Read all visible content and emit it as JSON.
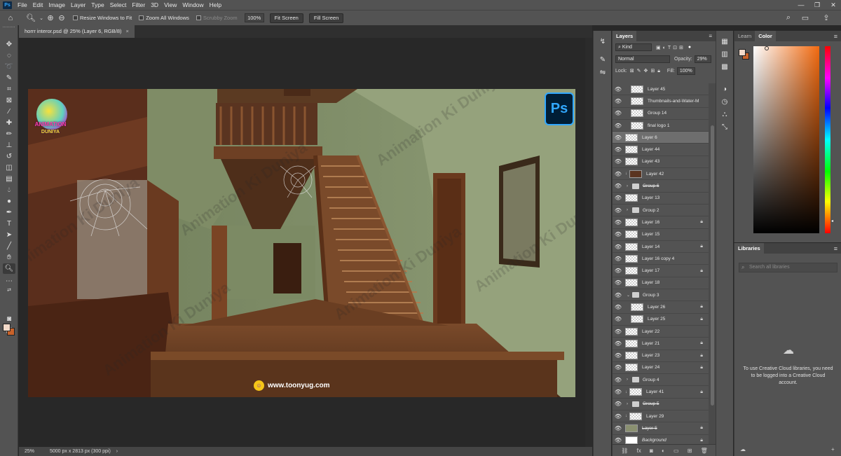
{
  "app": {
    "menu": [
      "File",
      "Edit",
      "Image",
      "Layer",
      "Type",
      "Select",
      "Filter",
      "3D",
      "View",
      "Window",
      "Help"
    ]
  },
  "options_bar": {
    "resize_windows": "Resize Windows to Fit",
    "zoom_all": "Zoom All Windows",
    "scrubby_zoom": "Scrubby Zoom",
    "zoom_value": "100%",
    "fit_screen": "Fit Screen",
    "fill_screen": "Fill Screen"
  },
  "document": {
    "tab_title": "horrr interor.psd @ 25% (Layer 6, RGB/8)",
    "tab_close": "×",
    "ps_badge": "Ps",
    "logo_line1": "ANIMATION",
    "logo_line2": "DUNIYA",
    "watermark": "Animation Ki Duniya",
    "website": "www.toonyug.com"
  },
  "status": {
    "zoom": "25%",
    "doc_info": "5000 px x 2813 px (300 ppi)"
  },
  "layers_panel": {
    "title": "Layers",
    "kind": "Kind",
    "blend": "Normal",
    "opacity_label": "Opacity:",
    "opacity_value": "29%",
    "lock_label": "Lock:",
    "fill_label": "Fill:",
    "fill_value": "100%",
    "footer_fx": "fx",
    "layers": [
      {
        "name": "Layer 45",
        "type": "layer",
        "indent": 1
      },
      {
        "name": "Thumbnails-and-Water-M",
        "type": "layer",
        "indent": 1
      },
      {
        "name": "Group 14",
        "type": "layer",
        "indent": 1
      },
      {
        "name": "final logo 1",
        "type": "layer",
        "indent": 1
      },
      {
        "name": "Layer 6",
        "type": "layer",
        "selected": true
      },
      {
        "name": "Layer 44",
        "type": "layer"
      },
      {
        "name": "Layer 43",
        "type": "layer"
      },
      {
        "name": "Layer 42",
        "type": "layer",
        "clip": true,
        "thumb_color": "#5a3420"
      },
      {
        "name": "Group 6",
        "type": "group",
        "strike": true
      },
      {
        "name": "Layer 13",
        "type": "layer"
      },
      {
        "name": "Group 2",
        "type": "group"
      },
      {
        "name": "Layer 16",
        "type": "layer",
        "lock": true
      },
      {
        "name": "Layer 15",
        "type": "layer"
      },
      {
        "name": "Layer 14",
        "type": "layer",
        "lock": true
      },
      {
        "name": "Layer 16 copy 4",
        "type": "layer"
      },
      {
        "name": "Layer 17",
        "type": "layer",
        "lock": true
      },
      {
        "name": "Layer 18",
        "type": "layer"
      },
      {
        "name": "Group 3",
        "type": "group",
        "open": true
      },
      {
        "name": "Layer 26",
        "type": "layer",
        "indent": 1,
        "lock": true
      },
      {
        "name": "Layer 25",
        "type": "layer",
        "indent": 1,
        "lock": true
      },
      {
        "name": "Layer 22",
        "type": "layer"
      },
      {
        "name": "Layer 21",
        "type": "layer",
        "lock": true
      },
      {
        "name": "Layer 23",
        "type": "layer",
        "lock": true
      },
      {
        "name": "Layer 24",
        "type": "layer",
        "lock": true
      },
      {
        "name": "Group 4",
        "type": "group"
      },
      {
        "name": "Layer 41",
        "type": "layer",
        "clip": true,
        "lock": true
      },
      {
        "name": "Group 5",
        "type": "group",
        "strike": true
      },
      {
        "name": "Layer 29",
        "type": "layer",
        "clip": true
      },
      {
        "name": "Layer 5",
        "type": "layer",
        "strike": true,
        "lock": true,
        "thumb_color": "#8a9070"
      },
      {
        "name": "Background",
        "type": "layer",
        "italic": true,
        "lock": true,
        "thumb_color": "#ffffff"
      }
    ]
  },
  "color_panel": {
    "tab_learn": "Learn",
    "tab_color": "Color",
    "foreground": "#f3dac9",
    "background": "#c8622a"
  },
  "libraries_panel": {
    "title": "Libraries",
    "search_placeholder": "Search all libraries",
    "message": "To use Creative Cloud libraries, you need to be logged into a Creative Cloud account."
  }
}
